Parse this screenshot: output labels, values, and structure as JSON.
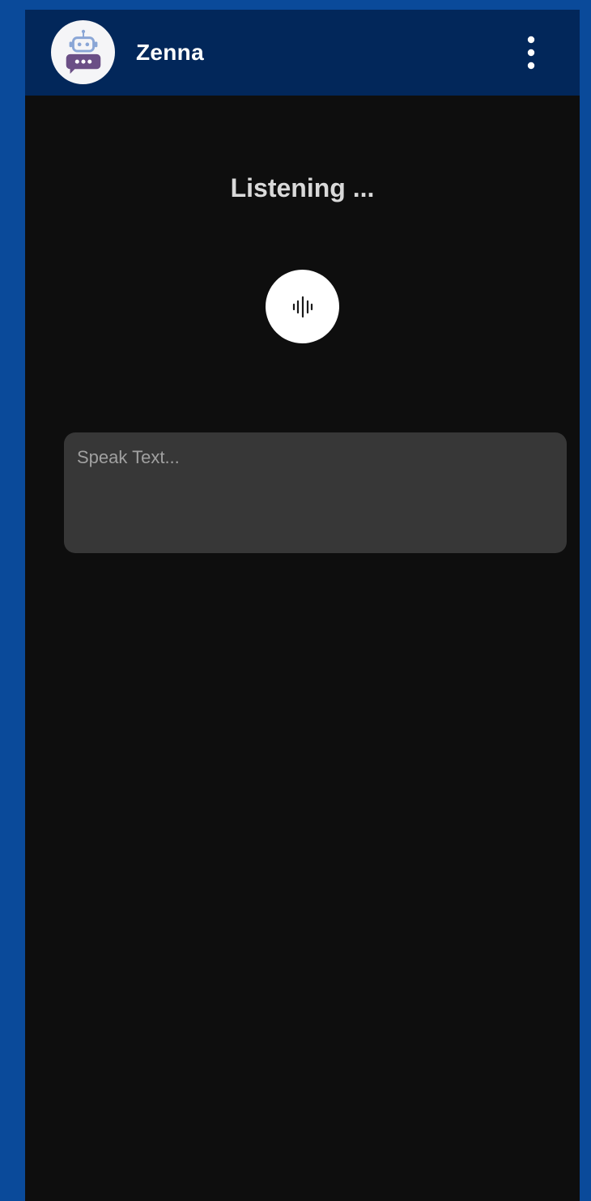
{
  "app_bar": {
    "title": "Zenna",
    "avatar_icon": "robot-chat-icon",
    "menu_icon": "more-vertical-icon",
    "background": "#02275a"
  },
  "main": {
    "status": "Listening ...",
    "mic_icon": "audio-waveform-icon",
    "input": {
      "value": "",
      "placeholder": "Speak Text..."
    },
    "background": "#0e0e0e"
  },
  "colors": {
    "page_border": "#0a4a9a",
    "input_background": "#373737",
    "robot_head": "#8aa6d6",
    "robot_bubble": "#6b4f86"
  }
}
